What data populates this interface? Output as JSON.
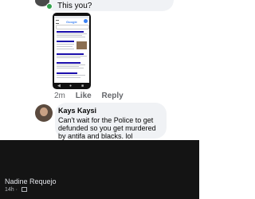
{
  "first_comment": {
    "text": "This you?"
  },
  "attachment": {
    "site_logo": "Google",
    "icons": [
      "menu-icon",
      "account-icon",
      "back-icon",
      "home-icon",
      "recent-apps-icon"
    ]
  },
  "comment_actions": {
    "time": "2m",
    "like": "Like",
    "reply": "Reply"
  },
  "second_comment": {
    "author": "Kays Kaysi",
    "text": "Can't wait for the Police to get defunded so you get murdered by antifa and blacks.  lol"
  },
  "post_footer": {
    "author": "Nadine Requejo",
    "time": "14h",
    "separator": "·",
    "privacy_icon": "friends-icon"
  },
  "colors": {
    "bubble": "#f0f2f5",
    "dark_panel": "#141414",
    "online": "#31a24c"
  }
}
